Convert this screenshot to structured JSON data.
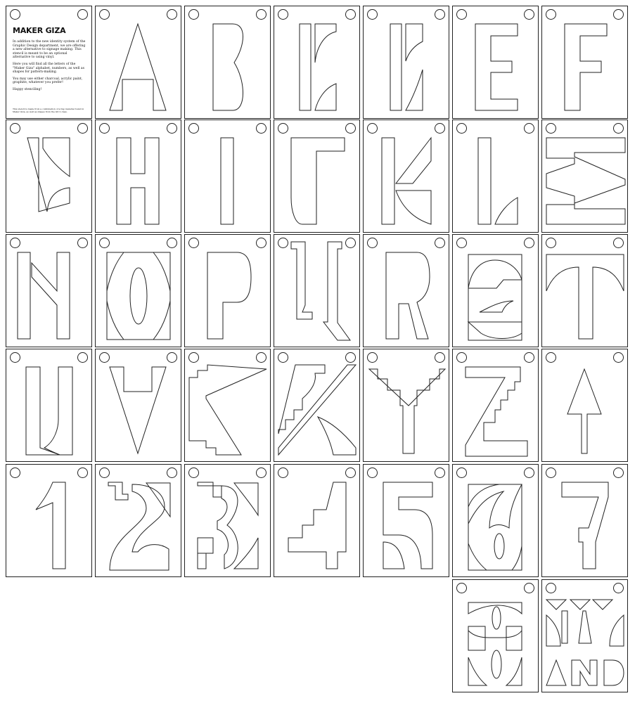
{
  "info_card": {
    "title": "MAKER GIZA",
    "paragraphs": [
      "In addition to the new identity system of the Graphic Design department, we are offering a new alternative to signage making. This stencil is meant to be an optional alternative to using vinyl.",
      "Here you will find all the letters of the \"Maker Giza\" alphabet, numbers, as well as shapes for pattern-making.",
      "You may use either charcoal, acrylic paint, graphite, whatever you prefer!",
      "Happy stenciling!"
    ],
    "fine_print": "This stencil is made from a combination of scrap material found in Maker Giza, as well as shapes from the GD 2 class."
  },
  "stencil_glyphs": [
    "A",
    "B",
    "C",
    "D",
    "E",
    "F",
    "G",
    "H",
    "I",
    "J",
    "K",
    "L",
    "M",
    "N",
    "O",
    "P",
    "Q",
    "R",
    "S",
    "T",
    "U",
    "V",
    "W",
    "X",
    "Y",
    "Z",
    "arrow",
    "1",
    "2",
    "3",
    "4",
    "5",
    "6",
    "7",
    "8",
    "M AND"
  ]
}
